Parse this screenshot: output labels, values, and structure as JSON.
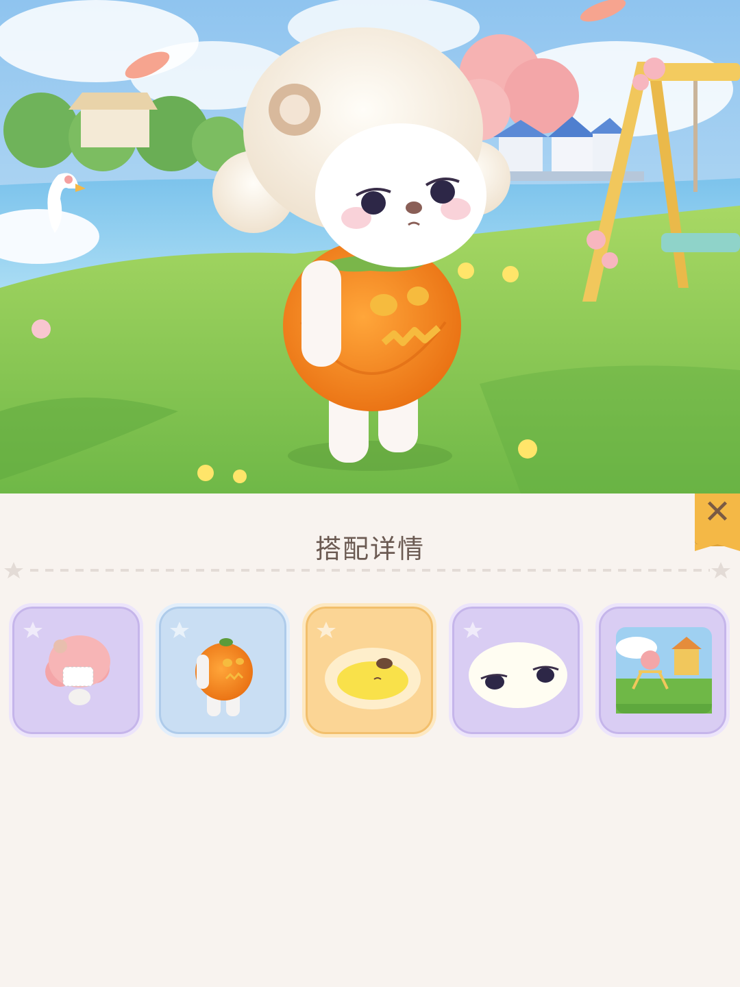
{
  "panel": {
    "title": "搭配详情",
    "close_icon": "close-icon"
  },
  "items": [
    {
      "slot": "hair",
      "rarity_color": "#d9cdf3",
      "icon": "pink-hair-icon"
    },
    {
      "slot": "outfit",
      "rarity_color": "#c9def3",
      "icon": "pumpkin-outfit-icon"
    },
    {
      "slot": "nose",
      "rarity_color": "#fbd595",
      "icon": "yellow-nose-icon"
    },
    {
      "slot": "eyes",
      "rarity_color": "#d9cdf3",
      "icon": "sleepy-eyes-icon"
    },
    {
      "slot": "background",
      "rarity_color": "#d9cdf3",
      "icon": "playground-scene-icon"
    }
  ],
  "colors": {
    "panel_bg": "#f8f3ef",
    "title_text": "#6b5a52",
    "close_tab": "#f4b846"
  }
}
